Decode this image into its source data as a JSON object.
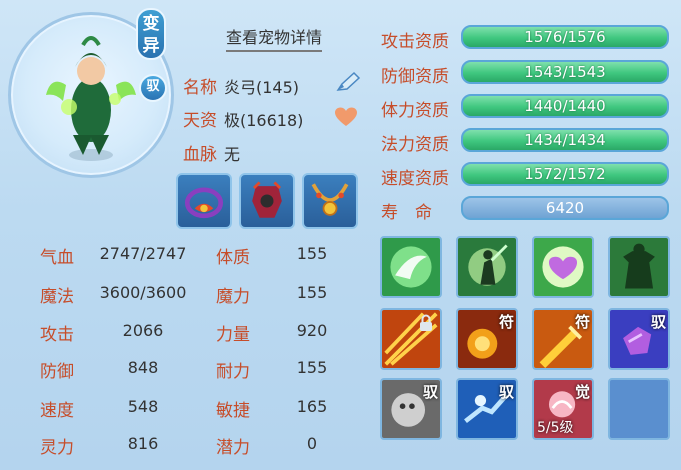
{
  "pet": {
    "variant_tag": "变\n异",
    "tame_tag": "驭",
    "detail_link": "查看宠物详情",
    "name_label": "名称",
    "name_value": "炎弓(145)",
    "talent_label": "天资",
    "talent_value": "极(16618)",
    "bloodline_label": "血脉",
    "bloodline_value": "无"
  },
  "stats": [
    {
      "label": "气血",
      "value": "2747/2747",
      "label2": "体质",
      "value2": "155"
    },
    {
      "label": "魔法",
      "value": "3600/3600",
      "label2": "魔力",
      "value2": "155"
    },
    {
      "label": "攻击",
      "value": "2066",
      "label2": "力量",
      "value2": "920"
    },
    {
      "label": "防御",
      "value": "848",
      "label2": "耐力",
      "value2": "155"
    },
    {
      "label": "速度",
      "value": "548",
      "label2": "敏捷",
      "value2": "165"
    },
    {
      "label": "灵力",
      "value": "816",
      "label2": "潜力",
      "value2": "0"
    }
  ],
  "aptitudes": [
    {
      "label": "攻击资质",
      "value": "1576/1576"
    },
    {
      "label": "防御资质",
      "value": "1543/1543"
    },
    {
      "label": "体力资质",
      "value": "1440/1440"
    },
    {
      "label": "法力资质",
      "value": "1434/1434"
    },
    {
      "label": "速度资质",
      "value": "1572/1572"
    }
  ],
  "life": {
    "label": "寿　命",
    "value": "6420"
  },
  "skills": {
    "tag_fu": "符",
    "tag_yu": "驭",
    "tag_jue": "觉",
    "level": "5/5级"
  },
  "colors": {
    "label": "#c64d2a",
    "bar": "#3fc77f",
    "accent": "#2a72b0"
  }
}
